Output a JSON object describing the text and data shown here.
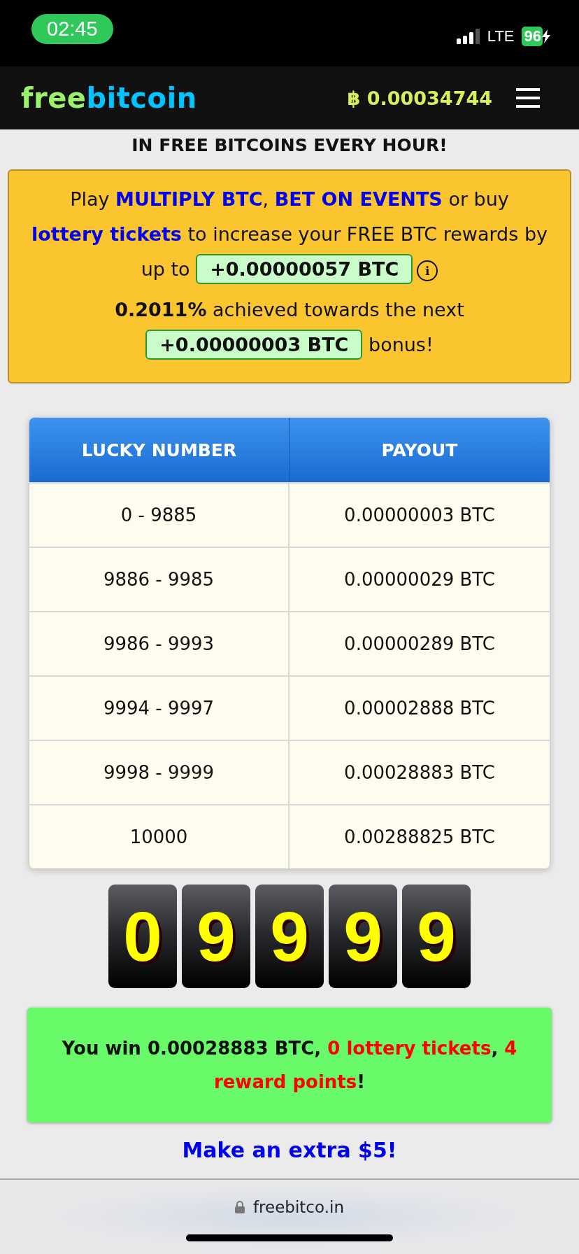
{
  "status_bar": {
    "time": "02:45",
    "network": "LTE",
    "battery": "96"
  },
  "header": {
    "logo_part_1": "free",
    "logo_part_2": "bitcoin",
    "balance_symbol": "฿",
    "balance": "0.00034744"
  },
  "headline": "IN FREE BITCOINS EVERY HOUR!",
  "promo": {
    "paragraphs": [
      [
        {
          "kind": "text",
          "text": "Play "
        },
        {
          "kind": "link",
          "text": "MULTIPLY BTC"
        },
        {
          "kind": "text",
          "text": ", "
        },
        {
          "kind": "link",
          "text": "BET ON EVENTS"
        },
        {
          "kind": "text",
          "text": " or buy "
        },
        {
          "kind": "link",
          "text": "lottery tickets"
        },
        {
          "kind": "text",
          "text": " to increase your FREE BTC rewards by up to "
        },
        {
          "kind": "badge",
          "text": "+0.00000057 BTC"
        },
        {
          "kind": "info",
          "text": "i"
        }
      ],
      [
        {
          "kind": "text",
          "text": "**0.2011%** achieved towards the next "
        },
        {
          "kind": "badge",
          "text": "+0.00000003 BTC"
        },
        {
          "kind": "text",
          "text": " bonus!"
        }
      ]
    ]
  },
  "payout_table": {
    "columns": [
      "LUCKY NUMBER",
      "PAYOUT"
    ],
    "rows": [
      [
        "0 - 9885",
        "0.00000003 BTC"
      ],
      [
        "9886 - 9985",
        "0.00000029 BTC"
      ],
      [
        "9986 - 9993",
        "0.00000289 BTC"
      ],
      [
        "9994 - 9997",
        "0.00002888 BTC"
      ],
      [
        "9998 - 9999",
        "0.00028883 BTC"
      ],
      [
        "10000",
        "0.00288825 BTC"
      ]
    ]
  },
  "roll_digits": [
    "0",
    "9",
    "9",
    "9",
    "9"
  ],
  "win_message": [
    {
      "kind": "plain",
      "text": "You win 0.00028883 BTC, "
    },
    {
      "kind": "highlight",
      "text": "0 lottery tickets"
    },
    {
      "kind": "plain",
      "text": ", "
    },
    {
      "kind": "highlight",
      "text": "4 reward points"
    },
    {
      "kind": "plain",
      "text": "!"
    }
  ],
  "extra_link": "Make an extra $5!",
  "browser": {
    "url": "freebitco.in"
  }
}
